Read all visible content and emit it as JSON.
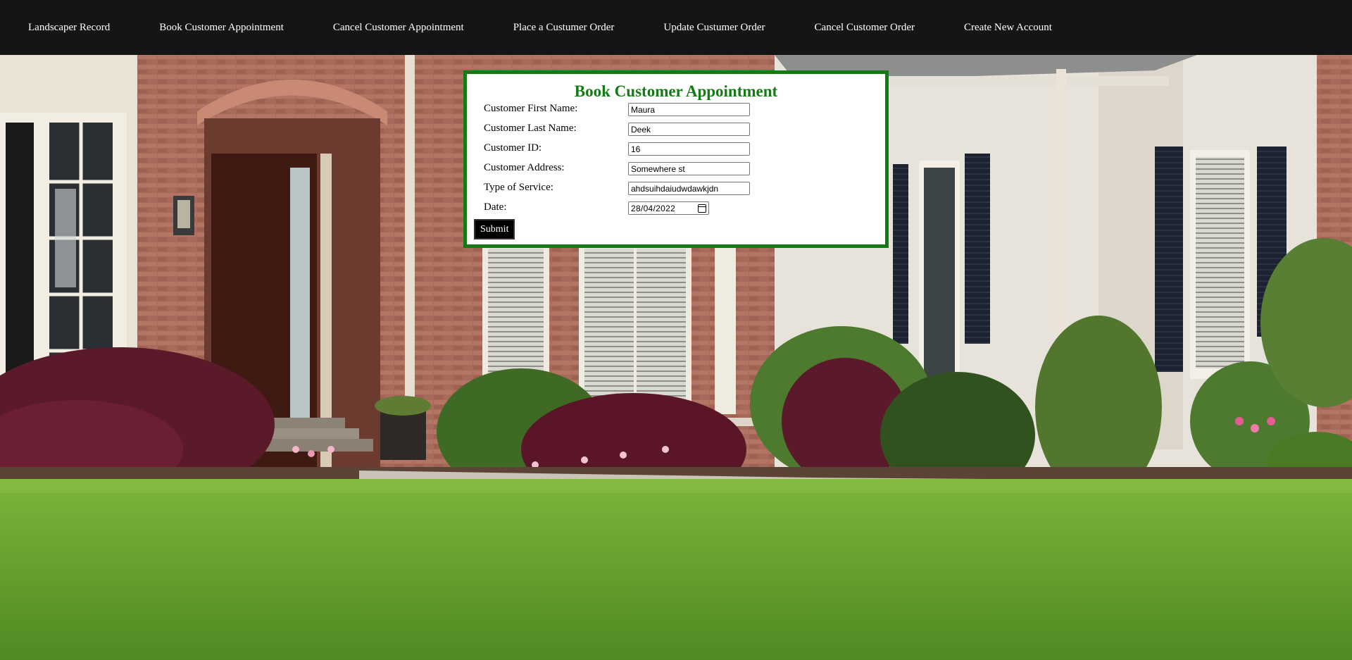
{
  "nav": {
    "items": [
      "Landscaper Record",
      "Book Customer Appointment",
      "Cancel Customer Appointment",
      "Place a Custumer Order",
      "Update Custumer Order",
      "Cancel Customer Order",
      "Create New Account"
    ]
  },
  "form": {
    "title": "Book Customer Appointment",
    "fields": [
      {
        "label": "Customer First Name:",
        "value": "Maura"
      },
      {
        "label": "Customer Last Name:",
        "value": "Deek"
      },
      {
        "label": "Customer ID:",
        "value": "16"
      },
      {
        "label": "Customer Address:",
        "value": "Somewhere st"
      },
      {
        "label": "Type of Service:",
        "value": "ahdsuihdaiudwdawkjdn"
      }
    ],
    "date": {
      "label": "Date:",
      "value": "28/04/2022"
    },
    "submit_label": "Submit"
  },
  "colors": {
    "nav_bg": "#151515",
    "accent_green": "#137b13",
    "lawn": "#5c9a2c",
    "brick": "#a7695a"
  }
}
